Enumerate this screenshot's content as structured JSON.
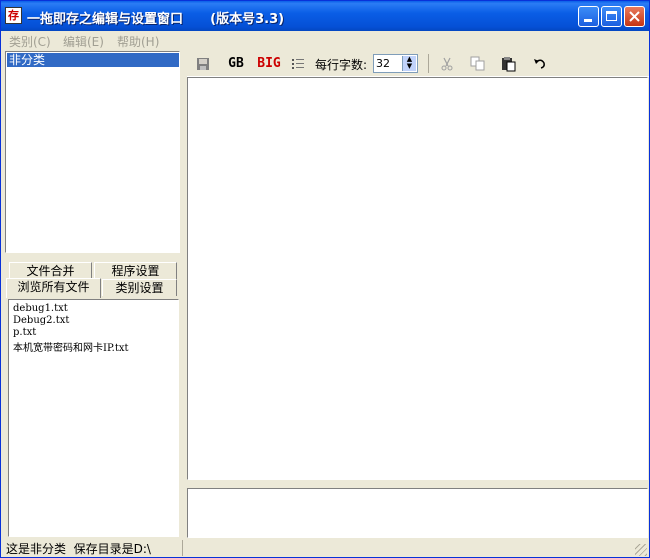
{
  "window": {
    "title": "一拖即存之编辑与设置窗口      (版本号3.3)",
    "icon": "app-logo-icon",
    "colors": {
      "titlebar": "#0a5ee6",
      "selection": "#316ac5",
      "menu_disabled": "#a19f93",
      "bg": "#ece9d8"
    }
  },
  "menu": [
    {
      "label": "类别(C)"
    },
    {
      "label": "编辑(E)"
    },
    {
      "label": "帮助(H)"
    }
  ],
  "categories": [
    "非分类"
  ],
  "tabs": {
    "row1": [
      "文件合并",
      "程序设置"
    ],
    "row2": [
      "浏览所有文件",
      "类别设置"
    ]
  },
  "files": [
    "debug1.txt",
    "Debug2.txt",
    "p.txt",
    "本机宽带密码和网卡IP.txt"
  ],
  "toolbar": {
    "save_icon": "save-icon",
    "gb_label": "GB",
    "big5_label": "BIG",
    "chars_per_line_label": "每行字数:",
    "chars_per_line_value": "32"
  },
  "status": {
    "text": "这是非分类  保存目录是D:\\"
  }
}
